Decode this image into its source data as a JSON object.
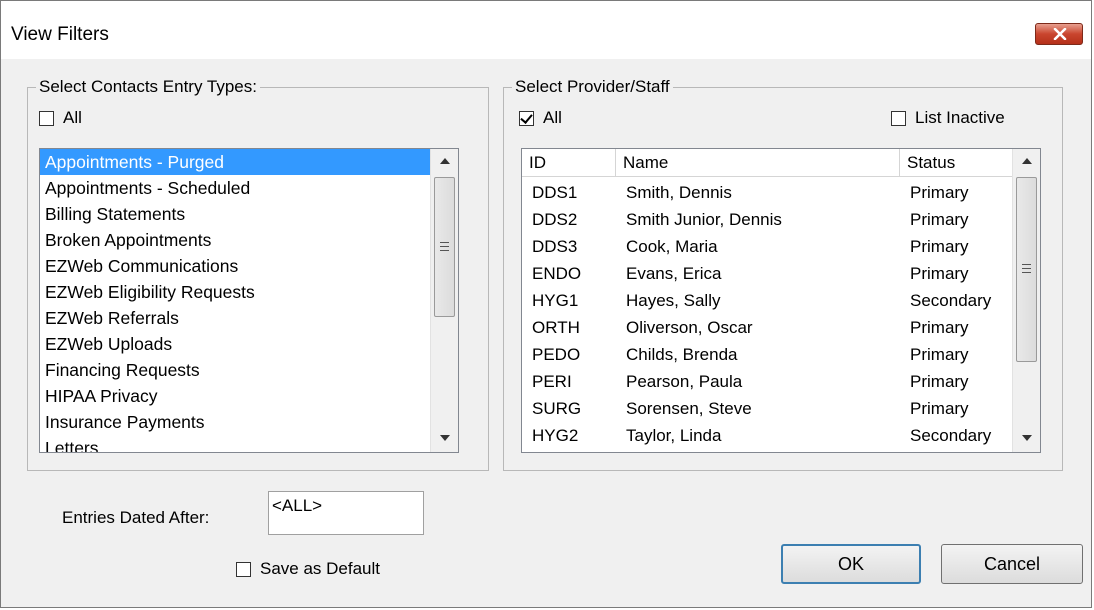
{
  "window": {
    "title": "View Filters"
  },
  "entry_types": {
    "legend": "Select Contacts Entry Types:",
    "all_label": "All",
    "all_checked": false,
    "items": [
      {
        "label": "Appointments - Purged",
        "selected": true
      },
      {
        "label": "Appointments - Scheduled",
        "selected": false
      },
      {
        "label": "Billing Statements",
        "selected": false
      },
      {
        "label": "Broken Appointments",
        "selected": false
      },
      {
        "label": "EZWeb Communications",
        "selected": false
      },
      {
        "label": "EZWeb Eligibility Requests",
        "selected": false
      },
      {
        "label": "EZWeb Referrals",
        "selected": false
      },
      {
        "label": "EZWeb Uploads",
        "selected": false
      },
      {
        "label": "Financing Requests",
        "selected": false
      },
      {
        "label": "HIPAA Privacy",
        "selected": false
      },
      {
        "label": "Insurance Payments",
        "selected": false
      },
      {
        "label": "Letters",
        "selected": false
      }
    ]
  },
  "providers": {
    "legend": "Select Provider/Staff",
    "all_label": "All",
    "all_checked": true,
    "list_inactive_label": "List Inactive",
    "list_inactive_checked": false,
    "columns": [
      "ID",
      "Name",
      "Status"
    ],
    "rows": [
      {
        "id": "DDS1",
        "name": "Smith, Dennis",
        "status": "Primary"
      },
      {
        "id": "DDS2",
        "name": "Smith Junior, Dennis",
        "status": "Primary"
      },
      {
        "id": "DDS3",
        "name": "Cook, Maria",
        "status": "Primary"
      },
      {
        "id": "ENDO",
        "name": "Evans, Erica",
        "status": "Primary"
      },
      {
        "id": "HYG1",
        "name": "Hayes, Sally",
        "status": "Secondary"
      },
      {
        "id": "ORTH",
        "name": "Oliverson, Oscar",
        "status": "Primary"
      },
      {
        "id": "PEDO",
        "name": "Childs, Brenda",
        "status": "Primary"
      },
      {
        "id": "PERI",
        "name": "Pearson, Paula",
        "status": "Primary"
      },
      {
        "id": "SURG",
        "name": "Sorensen, Steve",
        "status": "Primary"
      },
      {
        "id": "HYG2",
        "name": "Taylor, Linda",
        "status": "Secondary"
      }
    ]
  },
  "entries_dated_after": {
    "label": "Entries Dated After:",
    "value": "<ALL>"
  },
  "save_default": {
    "label": "Save as Default",
    "checked": false
  },
  "buttons": {
    "ok": "OK",
    "cancel": "Cancel"
  },
  "colors": {
    "selection": "#3399ff",
    "close_button": "#c9452e",
    "dialog_bg": "#f0f0f0"
  }
}
